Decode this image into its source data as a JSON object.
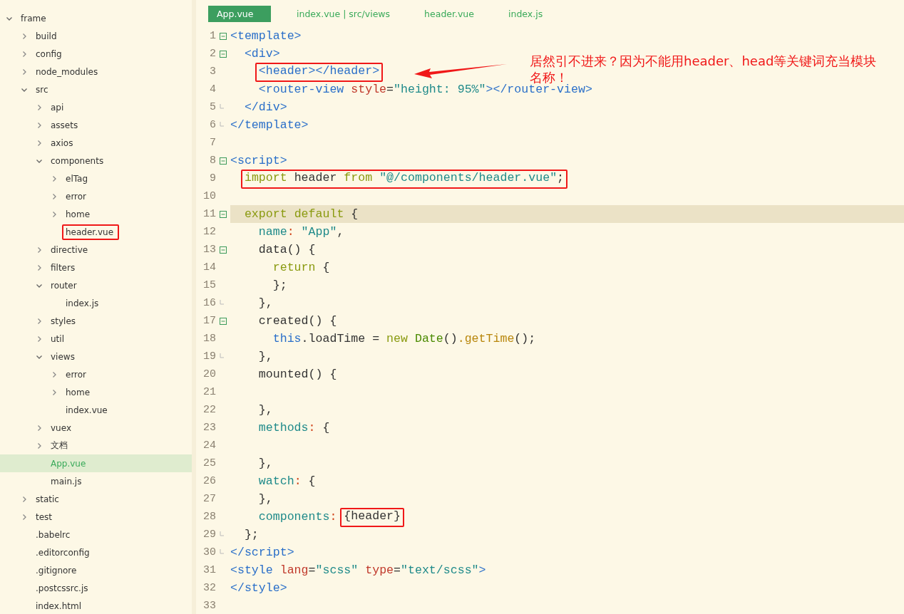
{
  "file_tree": [
    {
      "label": "frame",
      "kind": "folder",
      "expanded": true,
      "selected": false,
      "children": [
        {
          "label": "build",
          "kind": "folder",
          "expanded": false,
          "selected": false
        },
        {
          "label": "config",
          "kind": "folder",
          "expanded": false,
          "selected": false
        },
        {
          "label": "node_modules",
          "kind": "folder",
          "expanded": false,
          "selected": false
        },
        {
          "label": "src",
          "kind": "folder",
          "expanded": true,
          "selected": false,
          "children": [
            {
              "label": "api",
              "kind": "folder",
              "expanded": false,
              "selected": false
            },
            {
              "label": "assets",
              "kind": "folder",
              "expanded": false,
              "selected": false
            },
            {
              "label": "axios",
              "kind": "folder",
              "expanded": false,
              "selected": false
            },
            {
              "label": "components",
              "kind": "folder",
              "expanded": true,
              "selected": false,
              "children": [
                {
                  "label": "elTag",
                  "kind": "folder",
                  "expanded": false,
                  "selected": false
                },
                {
                  "label": "error",
                  "kind": "folder",
                  "expanded": false,
                  "selected": false
                },
                {
                  "label": "home",
                  "kind": "folder",
                  "expanded": false,
                  "selected": false
                },
                {
                  "label": "header.vue",
                  "kind": "file",
                  "selected": false,
                  "annotated": true
                }
              ]
            },
            {
              "label": "directive",
              "kind": "folder",
              "expanded": false,
              "selected": false
            },
            {
              "label": "filters",
              "kind": "folder",
              "expanded": false,
              "selected": false
            },
            {
              "label": "router",
              "kind": "folder",
              "expanded": true,
              "selected": false,
              "children": [
                {
                  "label": "index.js",
                  "kind": "file",
                  "selected": false
                }
              ]
            },
            {
              "label": "styles",
              "kind": "folder",
              "expanded": false,
              "selected": false
            },
            {
              "label": "util",
              "kind": "folder",
              "expanded": false,
              "selected": false
            },
            {
              "label": "views",
              "kind": "folder",
              "expanded": true,
              "selected": false,
              "children": [
                {
                  "label": "error",
                  "kind": "folder",
                  "expanded": false,
                  "selected": false
                },
                {
                  "label": "home",
                  "kind": "folder",
                  "expanded": false,
                  "selected": false
                },
                {
                  "label": "index.vue",
                  "kind": "file",
                  "selected": false
                }
              ]
            },
            {
              "label": "vuex",
              "kind": "folder",
              "expanded": false,
              "selected": false
            },
            {
              "label": "文档",
              "kind": "folder",
              "expanded": false,
              "selected": false
            },
            {
              "label": "App.vue",
              "kind": "file",
              "selected": true
            },
            {
              "label": "main.js",
              "kind": "file",
              "selected": false
            }
          ]
        },
        {
          "label": "static",
          "kind": "folder",
          "expanded": false,
          "selected": false
        },
        {
          "label": "test",
          "kind": "folder",
          "expanded": false,
          "selected": false
        },
        {
          "label": ".babelrc",
          "kind": "file",
          "selected": false
        },
        {
          "label": ".editorconfig",
          "kind": "file",
          "selected": false
        },
        {
          "label": ".gitignore",
          "kind": "file",
          "selected": false
        },
        {
          "label": ".postcssrc.js",
          "kind": "file",
          "selected": false
        },
        {
          "label": "index.html",
          "kind": "file",
          "selected": false
        }
      ]
    }
  ],
  "tabs": [
    {
      "label": "App.vue",
      "selected": true
    },
    {
      "label": "index.vue | src/views",
      "selected": false
    },
    {
      "label": "header.vue",
      "selected": false
    },
    {
      "label": "index.js",
      "selected": false
    }
  ],
  "code_lines": [
    {
      "number": "1",
      "collapsible": true,
      "fold_end": false,
      "current": false,
      "tokens": [
        {
          "text": "<template>",
          "kind": "tag"
        }
      ]
    },
    {
      "number": "2",
      "collapsible": true,
      "fold_end": false,
      "current": false,
      "tokens": [
        {
          "text": "  <div>",
          "kind": "tag"
        }
      ]
    },
    {
      "number": "3",
      "collapsible": false,
      "fold_end": false,
      "current": false,
      "tokens": [
        {
          "text": "    <header></header>",
          "kind": "tag",
          "boxed": true
        }
      ]
    },
    {
      "number": "4",
      "collapsible": false,
      "fold_end": false,
      "current": false,
      "tokens": [
        {
          "text": "    <router-view",
          "kind": "tag"
        },
        {
          "text": " style",
          "kind": "attr"
        },
        {
          "text": "=",
          "kind": "plain"
        },
        {
          "text": "\"height: 95%\"",
          "kind": "string"
        },
        {
          "text": "></router-view>",
          "kind": "tag"
        }
      ]
    },
    {
      "number": "5",
      "collapsible": false,
      "fold_end": true,
      "current": false,
      "tokens": [
        {
          "text": "  </div>",
          "kind": "tag"
        }
      ]
    },
    {
      "number": "6",
      "collapsible": false,
      "fold_end": true,
      "current": false,
      "tokens": [
        {
          "text": "</template>",
          "kind": "tag"
        }
      ]
    },
    {
      "number": "7",
      "collapsible": false,
      "fold_end": false,
      "current": false
    },
    {
      "number": "8",
      "collapsible": true,
      "fold_end": false,
      "current": false,
      "tokens": [
        {
          "text": "<script>",
          "kind": "tag"
        }
      ]
    },
    {
      "number": "9",
      "collapsible": false,
      "fold_end": false,
      "current": false,
      "tokens": [
        {
          "text": "  import",
          "kind": "keyword",
          "boxed": true
        },
        {
          "text": " header ",
          "kind": "plain",
          "boxed": true
        },
        {
          "text": "from",
          "kind": "keyword",
          "boxed": true
        },
        {
          "text": " \"@/components/header.vue\"",
          "kind": "string",
          "boxed": true
        },
        {
          "text": ";",
          "kind": "plain",
          "boxed": true
        }
      ]
    },
    {
      "number": "10",
      "collapsible": false,
      "fold_end": false,
      "current": false
    },
    {
      "number": "11",
      "collapsible": true,
      "fold_end": false,
      "current": true,
      "tokens": [
        {
          "text": "  export",
          "kind": "keyword"
        },
        {
          "text": " default",
          "kind": "keyword"
        },
        {
          "text": " {",
          "kind": "plain"
        }
      ]
    },
    {
      "number": "12",
      "collapsible": false,
      "fold_end": false,
      "current": false,
      "tokens": [
        {
          "text": "    name",
          "kind": "prop"
        },
        {
          "text": ":",
          "kind": "colon"
        },
        {
          "text": " \"App\"",
          "kind": "string"
        },
        {
          "text": ",",
          "kind": "plain"
        }
      ]
    },
    {
      "number": "13",
      "collapsible": true,
      "fold_end": false,
      "current": false,
      "tokens": [
        {
          "text": "    data() {",
          "kind": "plain"
        }
      ]
    },
    {
      "number": "14",
      "collapsible": false,
      "fold_end": false,
      "current": false,
      "tokens": [
        {
          "text": "      return",
          "kind": "keyword"
        },
        {
          "text": " {",
          "kind": "plain"
        }
      ]
    },
    {
      "number": "15",
      "collapsible": false,
      "fold_end": false,
      "current": false,
      "tokens": [
        {
          "text": "      };",
          "kind": "plain"
        }
      ]
    },
    {
      "number": "16",
      "collapsible": false,
      "fold_end": true,
      "current": false,
      "tokens": [
        {
          "text": "    },",
          "kind": "plain"
        }
      ]
    },
    {
      "number": "17",
      "collapsible": true,
      "fold_end": false,
      "current": false,
      "tokens": [
        {
          "text": "    created() {",
          "kind": "plain"
        }
      ]
    },
    {
      "number": "18",
      "collapsible": false,
      "fold_end": false,
      "current": false,
      "tokens": [
        {
          "text": "      this",
          "kind": "this"
        },
        {
          "text": ".loadTime = ",
          "kind": "plain"
        },
        {
          "text": "new",
          "kind": "keyword"
        },
        {
          "text": " Date",
          "kind": "class"
        },
        {
          "text": "()",
          "kind": "plain"
        },
        {
          "text": ".getTime",
          "kind": "method"
        },
        {
          "text": "();",
          "kind": "plain"
        }
      ]
    },
    {
      "number": "19",
      "collapsible": false,
      "fold_end": true,
      "current": false,
      "tokens": [
        {
          "text": "    },",
          "kind": "plain"
        }
      ]
    },
    {
      "number": "20",
      "collapsible": false,
      "fold_end": false,
      "current": false,
      "tokens": [
        {
          "text": "    mounted() {",
          "kind": "plain"
        }
      ]
    },
    {
      "number": "21",
      "collapsible": false,
      "fold_end": false,
      "current": false
    },
    {
      "number": "22",
      "collapsible": false,
      "fold_end": false,
      "current": false,
      "tokens": [
        {
          "text": "    },",
          "kind": "plain"
        }
      ]
    },
    {
      "number": "23",
      "collapsible": false,
      "fold_end": false,
      "current": false,
      "tokens": [
        {
          "text": "    methods",
          "kind": "prop"
        },
        {
          "text": ":",
          "kind": "colon"
        },
        {
          "text": " {",
          "kind": "plain"
        }
      ]
    },
    {
      "number": "24",
      "collapsible": false,
      "fold_end": false,
      "current": false
    },
    {
      "number": "25",
      "collapsible": false,
      "fold_end": false,
      "current": false,
      "tokens": [
        {
          "text": "    },",
          "kind": "plain"
        }
      ]
    },
    {
      "number": "26",
      "collapsible": false,
      "fold_end": false,
      "current": false,
      "tokens": [
        {
          "text": "    watch",
          "kind": "prop"
        },
        {
          "text": ":",
          "kind": "colon"
        },
        {
          "text": " {",
          "kind": "plain"
        }
      ]
    },
    {
      "number": "27",
      "collapsible": false,
      "fold_end": false,
      "current": false,
      "tokens": [
        {
          "text": "    },",
          "kind": "plain"
        }
      ]
    },
    {
      "number": "28",
      "collapsible": false,
      "fold_end": false,
      "current": false,
      "tokens": [
        {
          "text": "    components",
          "kind": "prop"
        },
        {
          "text": ":",
          "kind": "colon"
        },
        {
          "text": " {header}",
          "kind": "plain",
          "boxed": true
        }
      ]
    },
    {
      "number": "29",
      "collapsible": false,
      "fold_end": true,
      "current": false,
      "tokens": [
        {
          "text": "  };",
          "kind": "plain"
        }
      ]
    },
    {
      "number": "30",
      "collapsible": false,
      "fold_end": true,
      "current": false,
      "tokens": [
        {
          "text": "</script>",
          "kind": "tag"
        }
      ]
    },
    {
      "number": "31",
      "collapsible": false,
      "fold_end": false,
      "current": false,
      "tokens": [
        {
          "text": "<style",
          "kind": "tag"
        },
        {
          "text": " lang",
          "kind": "attr"
        },
        {
          "text": "=",
          "kind": "plain"
        },
        {
          "text": "\"scss\"",
          "kind": "string"
        },
        {
          "text": " type",
          "kind": "attr"
        },
        {
          "text": "=",
          "kind": "plain"
        },
        {
          "text": "\"text/scss\"",
          "kind": "string"
        },
        {
          "text": ">",
          "kind": "tag"
        }
      ]
    },
    {
      "number": "32",
      "collapsible": false,
      "fold_end": false,
      "current": false,
      "tokens": [
        {
          "text": "</style>",
          "kind": "tag"
        }
      ]
    },
    {
      "number": "33",
      "collapsible": false,
      "fold_end": false,
      "current": false
    }
  ],
  "annotation": {
    "text": "居然引不进来？因为不能用header、head等关键词充当模块名称！"
  }
}
